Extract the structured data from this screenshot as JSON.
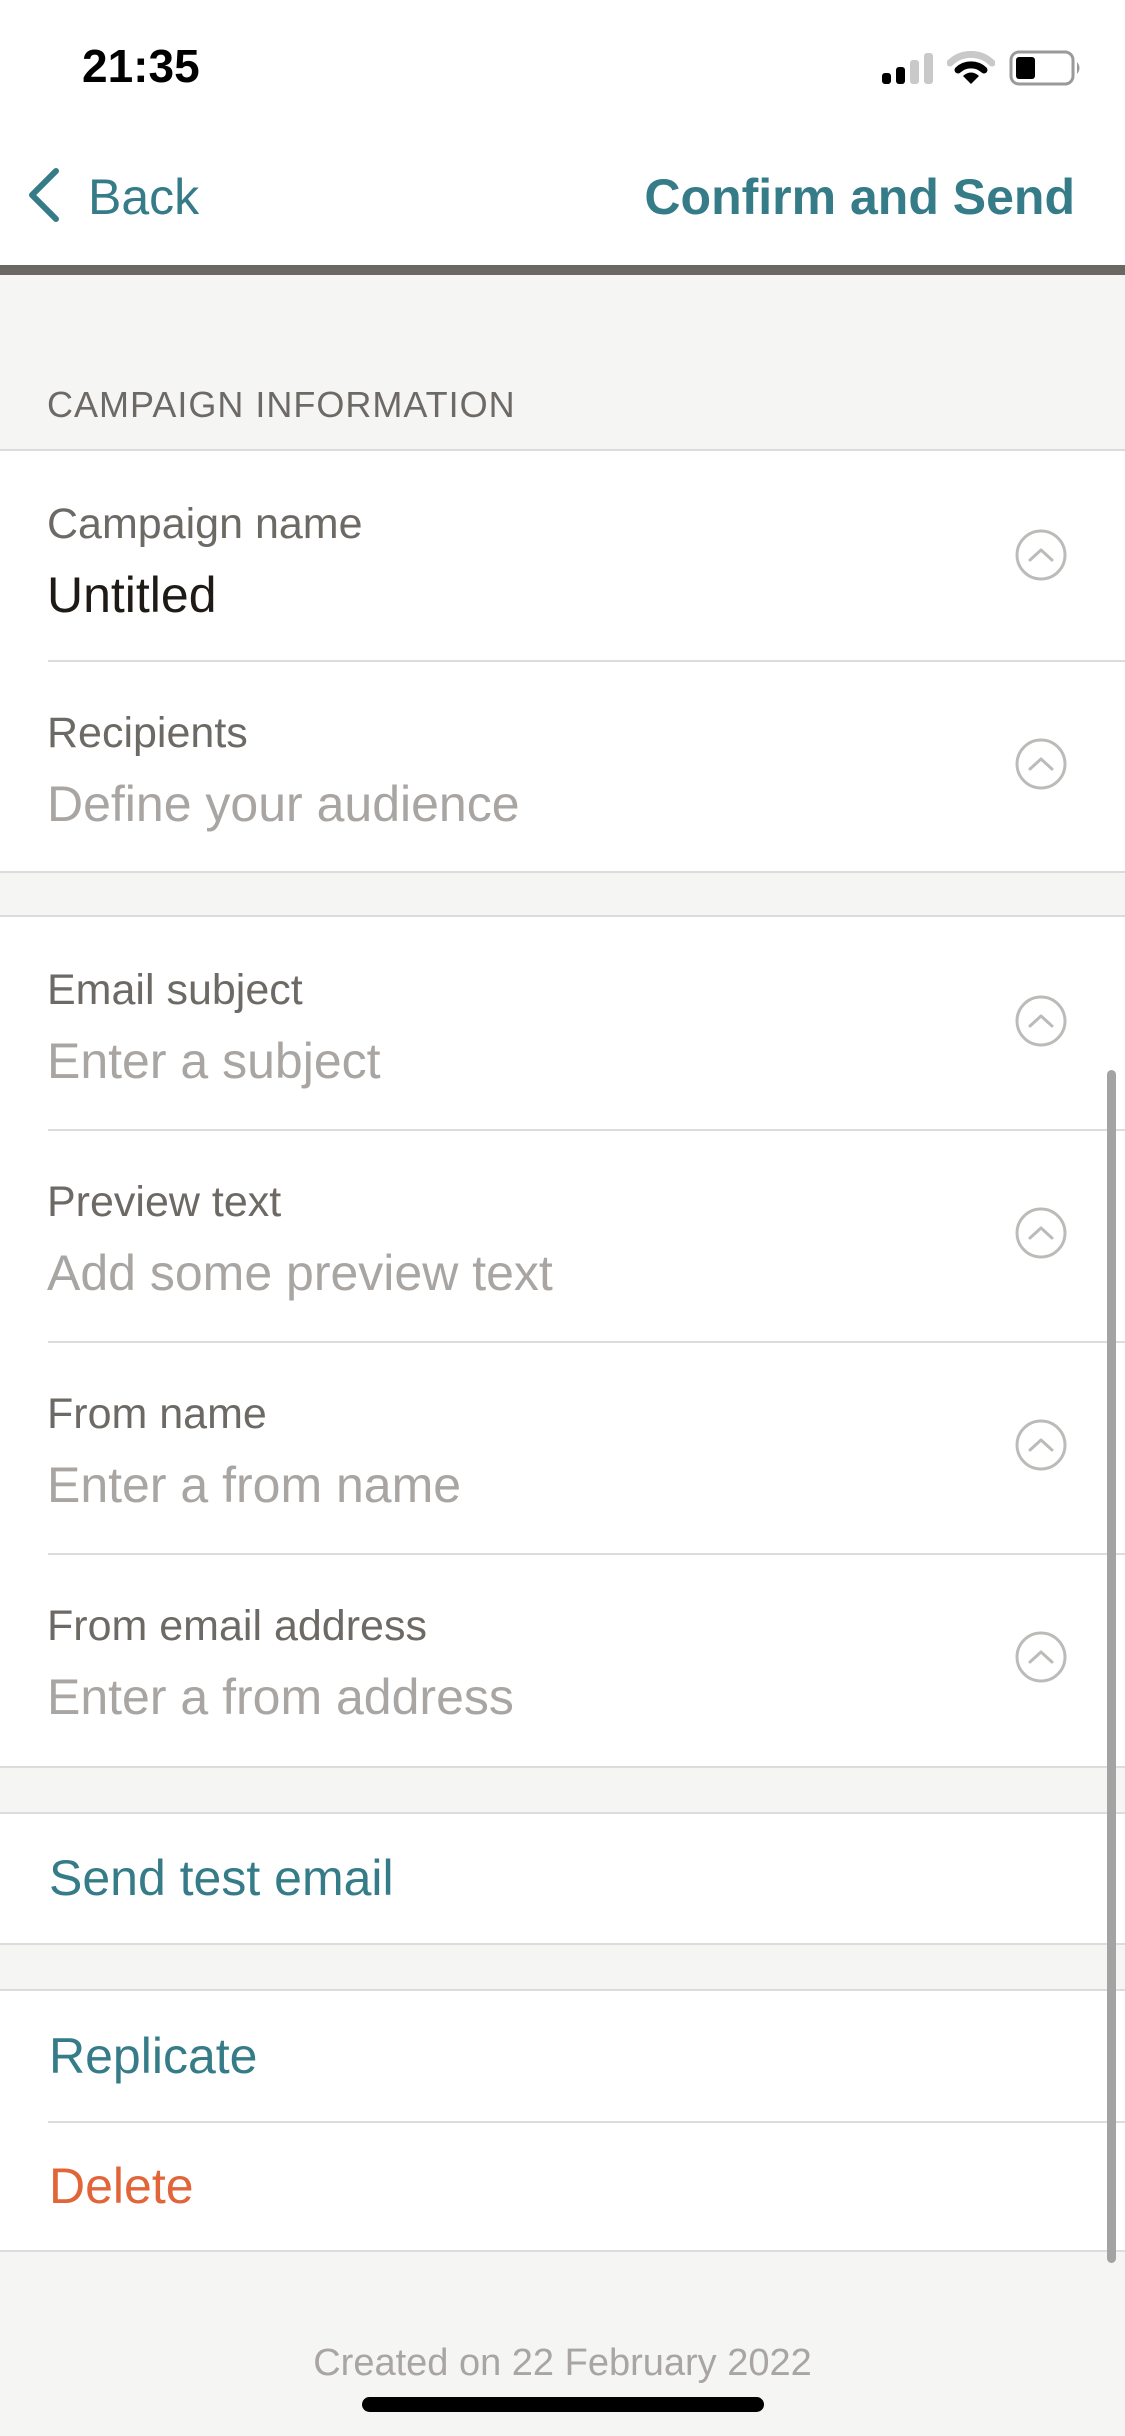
{
  "status_bar": {
    "time": "21:35",
    "signal_bars_active": 2,
    "signal_bars_total": 4,
    "battery_level": 0.33,
    "icons": [
      "signal-icon",
      "wifi-icon",
      "battery-icon"
    ]
  },
  "nav": {
    "back_label": "Back",
    "back_icon": "chevron-left-icon",
    "confirm_label": "Confirm and Send"
  },
  "section": {
    "title": "CAMPAIGN INFORMATION"
  },
  "groups": {
    "campaign": [
      {
        "label": "Campaign name",
        "value": "Untitled",
        "is_placeholder": false,
        "icon": "chevron-up-circle-icon"
      },
      {
        "label": "Recipients",
        "value": "Define your audience",
        "is_placeholder": true,
        "icon": "chevron-up-circle-icon"
      }
    ],
    "email": [
      {
        "label": "Email subject",
        "value": "Enter a subject",
        "is_placeholder": true,
        "icon": "chevron-up-circle-icon"
      },
      {
        "label": "Preview text",
        "value": "Add some preview text",
        "is_placeholder": true,
        "icon": "chevron-up-circle-icon"
      },
      {
        "label": "From name",
        "value": "Enter a from name",
        "is_placeholder": true,
        "icon": "chevron-up-circle-icon"
      },
      {
        "label": "From email address",
        "value": "Enter a from address",
        "is_placeholder": true,
        "icon": "chevron-up-circle-icon"
      }
    ]
  },
  "actions": {
    "send_test": "Send test email",
    "replicate": "Replicate",
    "delete": "Delete"
  },
  "footer": {
    "created": "Created on 22 February 2022"
  },
  "colors": {
    "accent": "#357c88",
    "danger": "#e2653a",
    "label": "#6d6964",
    "placeholder": "#a8a5a2",
    "value": "#1e1a16",
    "background": "#f5f5f3",
    "divider": "#6b6762"
  }
}
